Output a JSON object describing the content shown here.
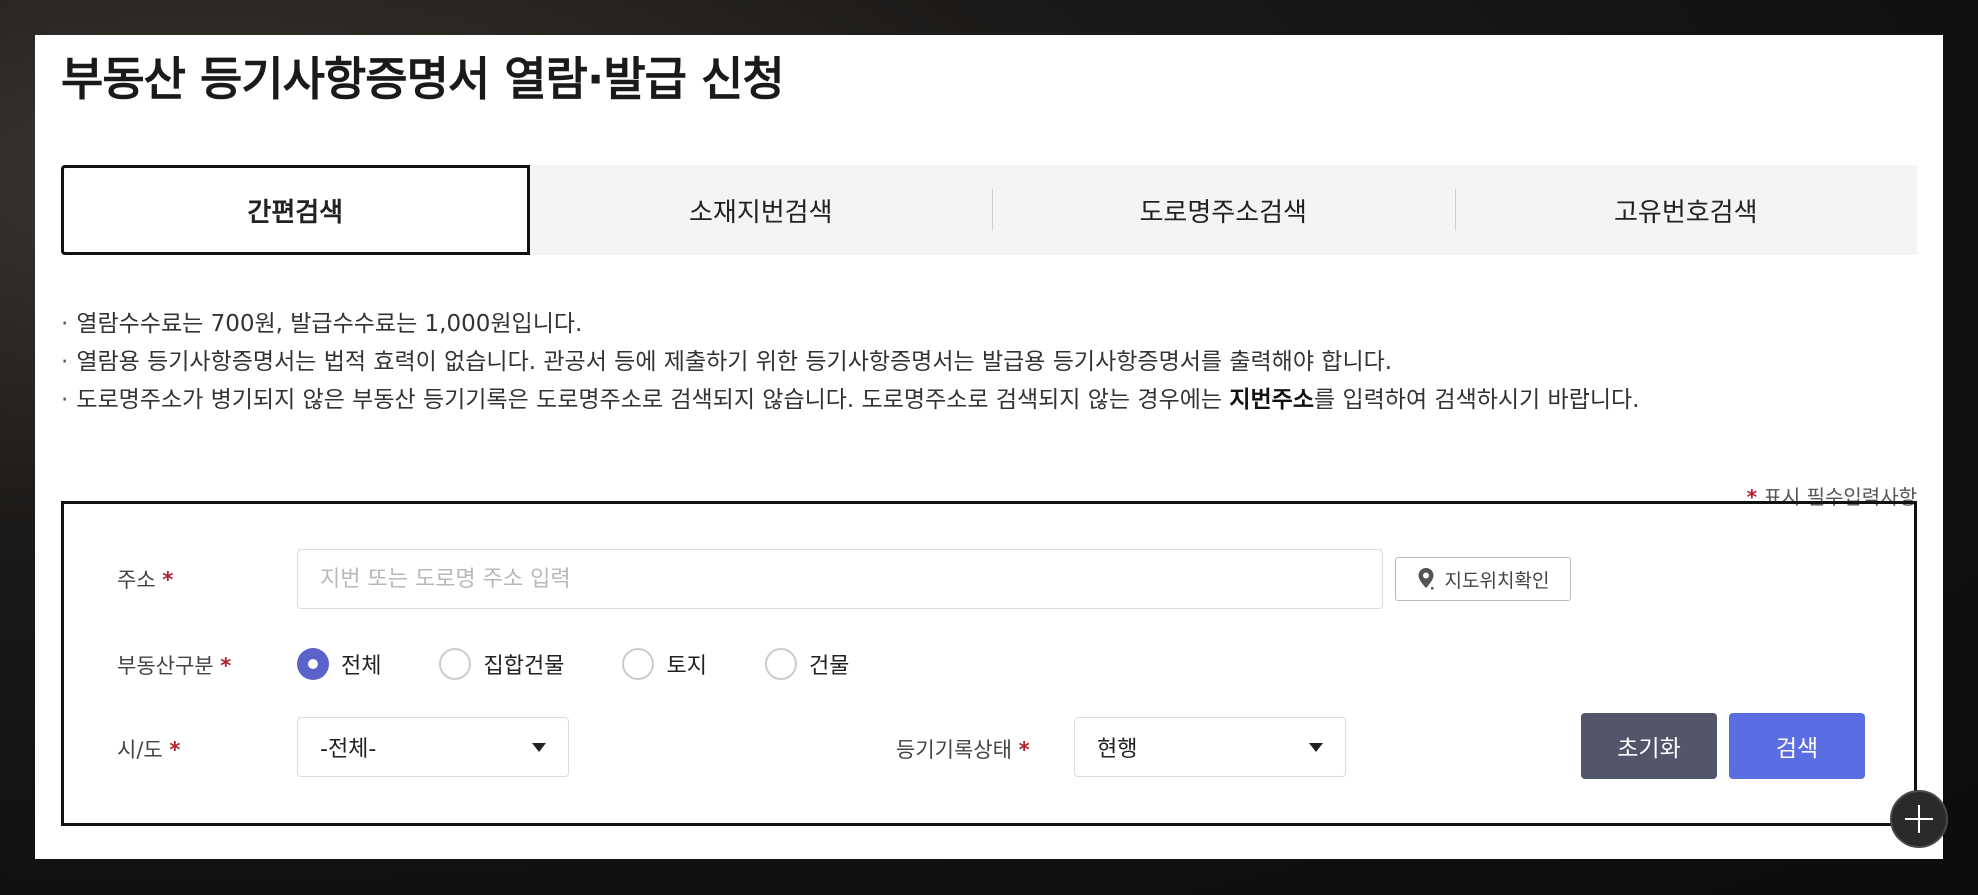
{
  "page": {
    "title": "부동산 등기사항증명서 열람·발급 신청"
  },
  "tabs": [
    {
      "label": "간편검색",
      "active": true
    },
    {
      "label": "소재지번검색",
      "active": false
    },
    {
      "label": "도로명주소검색",
      "active": false
    },
    {
      "label": "고유번호검색",
      "active": false
    }
  ],
  "notices": {
    "bullet": "·",
    "line1": "열람수수료는  700원, 발급수수료는  1,000원입니다.",
    "line2": "열람용 등기사항증명서는 법적 효력이 없습니다. 관공서 등에 제출하기 위한 등기사항증명서는 발급용 등기사항증명서를 출력해야 합니다.",
    "line3_before": "도로명주소가 병기되지 않은 부동산 등기기록은 도로명주소로 검색되지 않습니다. 도로명주소로 검색되지 않는 경우에는 ",
    "line3_bold": "지번주소",
    "line3_after": "를 입력하여 검색하시기 바랍니다."
  },
  "required_note": {
    "star": "*",
    "text": "표시 필수입력사항"
  },
  "form": {
    "address_label": "주소",
    "address_placeholder": "지번 또는 도로명 주소 입력",
    "address_value": "",
    "map_button_label": "지도위치확인",
    "property_type_label": "부동산구분",
    "property_types": [
      {
        "label": "전체",
        "checked": true
      },
      {
        "label": "집합건물",
        "checked": false
      },
      {
        "label": "토지",
        "checked": false
      },
      {
        "label": "건물",
        "checked": false
      }
    ],
    "region_label": "시/도",
    "region_value": "-전체-",
    "record_status_label": "등기기록상태",
    "record_status_value": "현행",
    "required_star": "*"
  },
  "buttons": {
    "reset": "초기화",
    "search": "검색"
  },
  "colors": {
    "accent": "#5b6ee1",
    "radio_checked": "#5a63c9",
    "reset_button": "#525668",
    "required_star": "#b21f2d"
  }
}
